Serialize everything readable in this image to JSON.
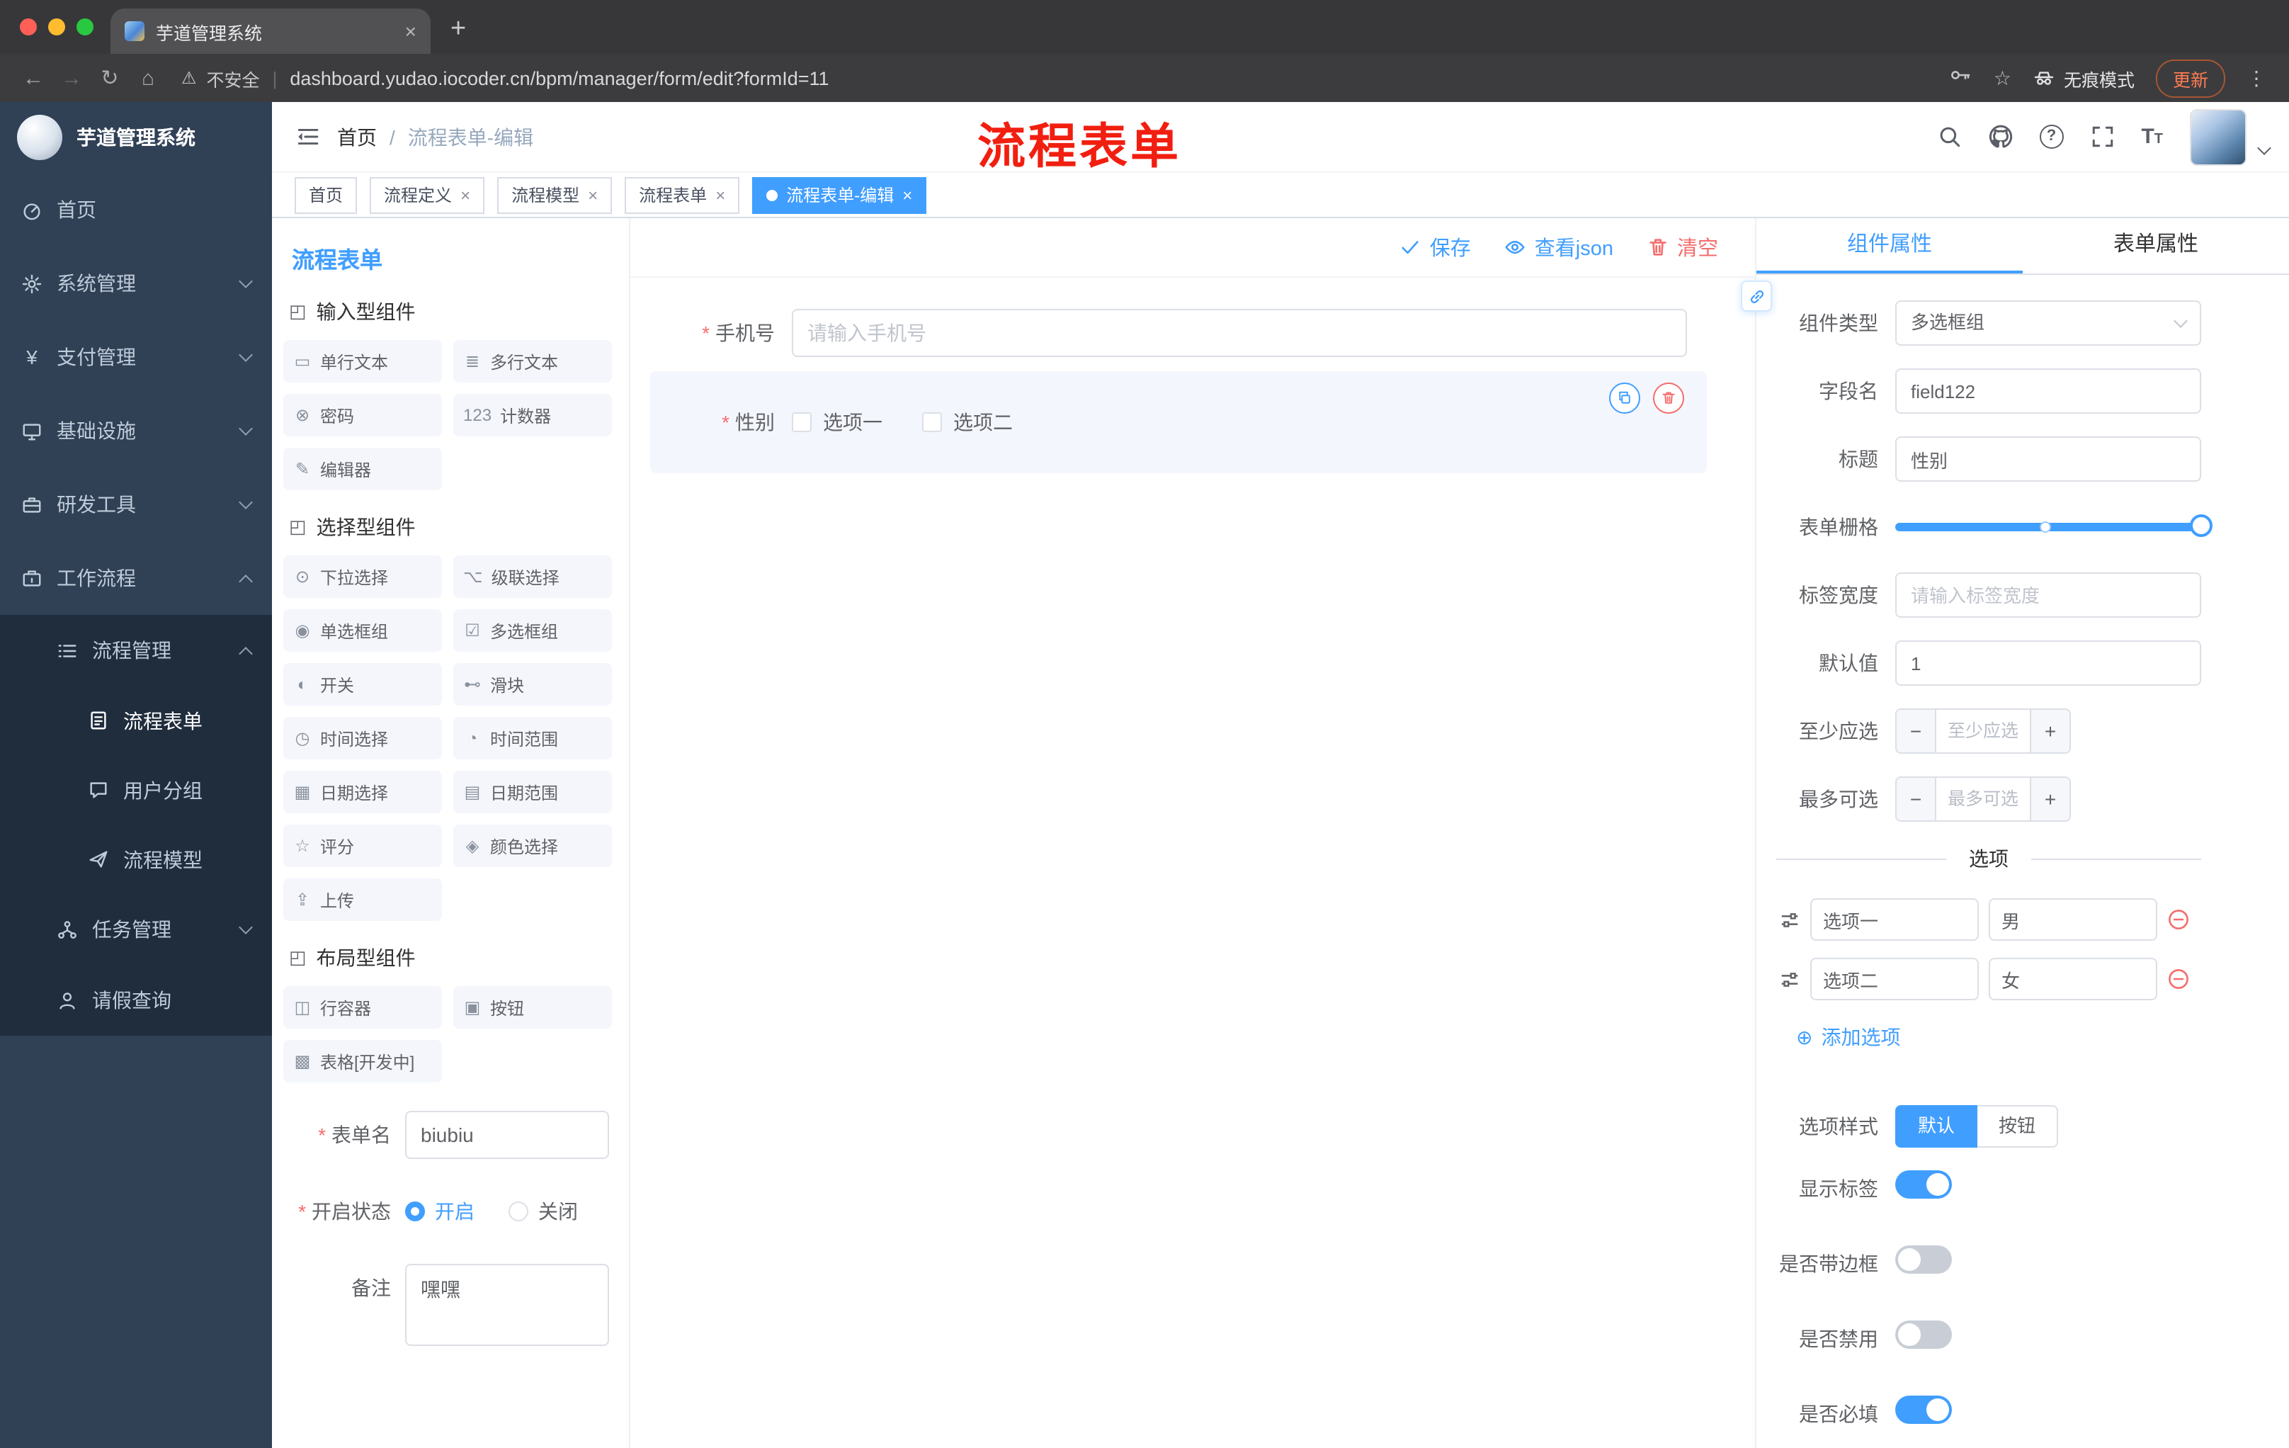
{
  "browser": {
    "tab_title": "芋道管理系统",
    "security_label": "不安全",
    "url": "dashboard.yudao.iocoder.cn/bpm/manager/form/edit?formId=11",
    "incognito_label": "无痕模式",
    "update_label": "更新"
  },
  "annotation": {
    "text": "流程表单",
    "color": "#f11f10"
  },
  "sidebar": {
    "logo_title": "芋道管理系统",
    "items": [
      {
        "label": "首页",
        "icon": "dashboard-icon",
        "level": 1
      },
      {
        "label": "系统管理",
        "icon": "gear-icon",
        "level": 1,
        "chevron": "down"
      },
      {
        "label": "支付管理",
        "icon": "payment-icon",
        "level": 1,
        "chevron": "down"
      },
      {
        "label": "基础设施",
        "icon": "infrastructure-icon",
        "level": 1,
        "chevron": "down"
      },
      {
        "label": "研发工具",
        "icon": "tools-icon",
        "level": 1,
        "chevron": "down"
      },
      {
        "label": "工作流程",
        "icon": "workflow-icon",
        "level": 1,
        "chevron": "up"
      },
      {
        "label": "流程管理",
        "icon": "process-manage-icon",
        "level": 2,
        "chevron": "up"
      },
      {
        "label": "流程表单",
        "icon": "form-icon",
        "level": 3,
        "active": true
      },
      {
        "label": "用户分组",
        "icon": "user-group-icon",
        "level": 3
      },
      {
        "label": "流程模型",
        "icon": "model-icon",
        "level": 3
      },
      {
        "label": "任务管理",
        "icon": "task-icon",
        "level": 2,
        "chevron": "down"
      },
      {
        "label": "请假查询",
        "icon": "leave-icon",
        "level": 2
      }
    ]
  },
  "header": {
    "breadcrumb_home": "首页",
    "breadcrumb_sep": "/",
    "breadcrumb_current": "流程表单-编辑"
  },
  "tags": [
    {
      "label": "首页",
      "closable": false,
      "active": false
    },
    {
      "label": "流程定义",
      "closable": true,
      "active": false
    },
    {
      "label": "流程模型",
      "closable": true,
      "active": false
    },
    {
      "label": "流程表单",
      "closable": true,
      "active": false
    },
    {
      "label": "流程表单-编辑",
      "closable": true,
      "active": true
    }
  ],
  "designer": {
    "panel_title": "流程表单",
    "groups": [
      {
        "title": "输入型组件",
        "icon": "component-group-icon",
        "items": [
          {
            "label": "单行文本",
            "icon": "single-text-icon"
          },
          {
            "label": "多行文本",
            "icon": "multi-text-icon"
          },
          {
            "label": "密码",
            "icon": "password-icon"
          },
          {
            "label": "计数器",
            "icon": "counter-icon"
          },
          {
            "label": "编辑器",
            "icon": "editor-icon"
          }
        ]
      },
      {
        "title": "选择型组件",
        "icon": "component-group-icon",
        "items": [
          {
            "label": "下拉选择",
            "icon": "select-icon"
          },
          {
            "label": "级联选择",
            "icon": "cascader-icon"
          },
          {
            "label": "单选框组",
            "icon": "radio-group-icon"
          },
          {
            "label": "多选框组",
            "icon": "checkbox-group-icon"
          },
          {
            "label": "开关",
            "icon": "switch-icon"
          },
          {
            "label": "滑块",
            "icon": "slider-icon"
          },
          {
            "label": "时间选择",
            "icon": "time-icon"
          },
          {
            "label": "时间范围",
            "icon": "time-range-icon"
          },
          {
            "label": "日期选择",
            "icon": "date-icon"
          },
          {
            "label": "日期范围",
            "icon": "date-range-icon"
          },
          {
            "label": "评分",
            "icon": "rate-icon"
          },
          {
            "label": "颜色选择",
            "icon": "color-icon"
          },
          {
            "label": "上传",
            "icon": "upload-icon"
          }
        ]
      },
      {
        "title": "布局型组件",
        "icon": "component-group-icon",
        "items": [
          {
            "label": "行容器",
            "icon": "row-icon"
          },
          {
            "label": "按钮",
            "icon": "button-icon"
          },
          {
            "label": "表格[开发中]",
            "icon": "table-icon"
          }
        ]
      }
    ],
    "meta": {
      "name_label": "表单名",
      "name_value": "biubiu",
      "status_label": "开启状态",
      "status_options": [
        "开启",
        "关闭"
      ],
      "status_selected": "开启",
      "remark_label": "备注",
      "remark_value": "嘿嘿"
    }
  },
  "canvas": {
    "actions": {
      "save": "保存",
      "view_json": "查看json",
      "clear": "清空"
    },
    "phone_field": {
      "label": "手机号",
      "required": true,
      "placeholder": "请输入手机号"
    },
    "gender_field": {
      "label": "性别",
      "required": true,
      "options": [
        "选项一",
        "选项二"
      ],
      "selected": true
    }
  },
  "properties": {
    "tab_component": "组件属性",
    "tab_form": "表单属性",
    "component_type_label": "组件类型",
    "component_type_value": "多选框组",
    "field_name_label": "字段名",
    "field_name_value": "field122",
    "title_label": "标题",
    "title_value": "性别",
    "grid_label": "表单栅格",
    "label_width_label": "标签宽度",
    "label_width_placeholder": "请输入标签宽度",
    "default_label": "默认值",
    "default_value": "1",
    "min_label": "至少应选",
    "min_placeholder": "至少应选",
    "max_label": "最多可选",
    "max_placeholder": "最多可选",
    "options_title": "选项",
    "options": [
      {
        "label": "选项一",
        "value": "男"
      },
      {
        "label": "选项二",
        "value": "女"
      }
    ],
    "add_option_label": "添加选项",
    "style_label": "选项样式",
    "style_options": [
      "默认",
      "按钮"
    ],
    "style_active": "默认",
    "toggles": [
      {
        "label": "显示标签",
        "on": true
      },
      {
        "label": "是否带边框",
        "on": false
      },
      {
        "label": "是否禁用",
        "on": false
      },
      {
        "label": "是否必填",
        "on": true
      }
    ]
  },
  "colors": {
    "accent": "#409eff",
    "danger": "#f56c6c",
    "annotation_red": "#f11f10",
    "sidebar_bg": "#304156",
    "sidebar_sub_bg": "#1f2d3d",
    "active_tag_bg": "#409eff"
  }
}
